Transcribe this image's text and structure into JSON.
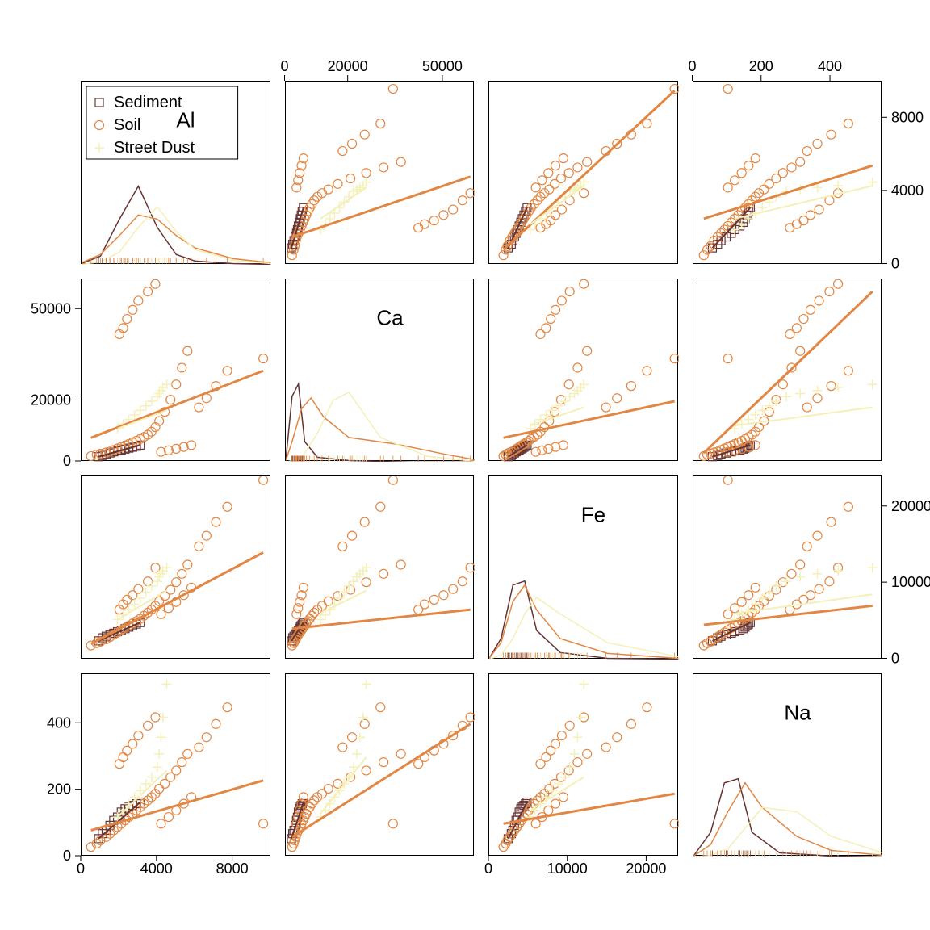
{
  "variables": [
    "Al",
    "Ca",
    "Fe",
    "Na"
  ],
  "groups": [
    "Sediment",
    "Soil",
    "Street Dust"
  ],
  "colors": {
    "Sediment": "#663333",
    "Soil": "#E28743",
    "Street Dust": "#F4F0B8"
  },
  "marker": {
    "Sediment": "square",
    "Soil": "circle",
    "Street Dust": "plus"
  },
  "ranges": {
    "Al": [
      0,
      10000
    ],
    "Ca": [
      0,
      60000
    ],
    "Fe": [
      0,
      24000
    ],
    "Na": [
      0,
      550
    ]
  },
  "axis_top": {
    "Ca": [
      0,
      20000,
      50000
    ],
    "Na": [
      0,
      200,
      400
    ]
  },
  "axis_bottom": {
    "Al": [
      0,
      4000,
      8000
    ],
    "Fe": [
      0,
      10000,
      20000
    ]
  },
  "axis_left": {
    "Ca": [
      0,
      20000,
      50000
    ],
    "Na": [
      0,
      200,
      400
    ]
  },
  "axis_right": {
    "Al": [
      0,
      4000,
      8000
    ],
    "Fe": [
      0,
      10000,
      20000
    ]
  },
  "legend": {
    "title": "",
    "items": [
      "Sediment",
      "Soil",
      "Street Dust"
    ]
  },
  "chart_data": {
    "type": "scatter_matrix",
    "variables": [
      "Al",
      "Ca",
      "Fe",
      "Na"
    ],
    "series": [
      {
        "name": "Sediment",
        "points": [
          {
            "Al": 900,
            "Ca": 1800,
            "Fe": 2400,
            "Na": 55
          },
          {
            "Al": 1100,
            "Ca": 2200,
            "Fe": 2800,
            "Na": 70
          },
          {
            "Al": 1300,
            "Ca": 2600,
            "Fe": 3000,
            "Na": 80
          },
          {
            "Al": 1500,
            "Ca": 3000,
            "Fe": 3200,
            "Na": 95
          },
          {
            "Al": 1700,
            "Ca": 3400,
            "Fe": 3400,
            "Na": 110
          },
          {
            "Al": 1900,
            "Ca": 3700,
            "Fe": 3600,
            "Na": 120
          },
          {
            "Al": 2100,
            "Ca": 4000,
            "Fe": 3800,
            "Na": 135
          },
          {
            "Al": 2300,
            "Ca": 4300,
            "Fe": 4000,
            "Na": 145
          },
          {
            "Al": 2500,
            "Ca": 4600,
            "Fe": 4200,
            "Na": 150
          },
          {
            "Al": 2700,
            "Ca": 4900,
            "Fe": 4400,
            "Na": 155
          },
          {
            "Al": 2900,
            "Ca": 5200,
            "Fe": 4600,
            "Na": 160
          },
          {
            "Al": 3100,
            "Ca": 5600,
            "Fe": 4800,
            "Na": 165
          }
        ]
      },
      {
        "name": "Soil",
        "points": [
          {
            "Al": 500,
            "Ca": 2000,
            "Fe": 1800,
            "Na": 30
          },
          {
            "Al": 800,
            "Ca": 2500,
            "Fe": 2100,
            "Na": 40
          },
          {
            "Al": 1000,
            "Ca": 2800,
            "Fe": 2300,
            "Na": 50
          },
          {
            "Al": 1300,
            "Ca": 3200,
            "Fe": 2600,
            "Na": 60
          },
          {
            "Al": 1500,
            "Ca": 3500,
            "Fe": 2900,
            "Na": 70
          },
          {
            "Al": 1700,
            "Ca": 4000,
            "Fe": 3200,
            "Na": 80
          },
          {
            "Al": 1900,
            "Ca": 4500,
            "Fe": 3500,
            "Na": 90
          },
          {
            "Al": 2100,
            "Ca": 5000,
            "Fe": 3800,
            "Na": 100
          },
          {
            "Al": 2300,
            "Ca": 5500,
            "Fe": 4100,
            "Na": 110
          },
          {
            "Al": 2500,
            "Ca": 6000,
            "Fe": 4400,
            "Na": 120
          },
          {
            "Al": 2700,
            "Ca": 6500,
            "Fe": 4700,
            "Na": 130
          },
          {
            "Al": 2900,
            "Ca": 7000,
            "Fe": 5000,
            "Na": 140
          },
          {
            "Al": 3100,
            "Ca": 7600,
            "Fe": 5300,
            "Na": 150
          },
          {
            "Al": 3300,
            "Ca": 8300,
            "Fe": 5700,
            "Na": 160
          },
          {
            "Al": 3500,
            "Ca": 9000,
            "Fe": 6100,
            "Na": 170
          },
          {
            "Al": 3700,
            "Ca": 10000,
            "Fe": 6500,
            "Na": 180
          },
          {
            "Al": 3900,
            "Ca": 11500,
            "Fe": 7000,
            "Na": 190
          },
          {
            "Al": 4100,
            "Ca": 13500,
            "Fe": 7600,
            "Na": 205
          },
          {
            "Al": 4400,
            "Ca": 16500,
            "Fe": 8300,
            "Na": 220
          },
          {
            "Al": 4700,
            "Ca": 20500,
            "Fe": 9100,
            "Na": 240
          },
          {
            "Al": 5000,
            "Ca": 25500,
            "Fe": 10100,
            "Na": 260
          },
          {
            "Al": 5300,
            "Ca": 31000,
            "Fe": 11200,
            "Na": 285
          },
          {
            "Al": 5600,
            "Ca": 36500,
            "Fe": 12400,
            "Na": 310
          },
          {
            "Al": 2000,
            "Ca": 42000,
            "Fe": 6500,
            "Na": 280
          },
          {
            "Al": 2200,
            "Ca": 44000,
            "Fe": 7200,
            "Na": 300
          },
          {
            "Al": 2400,
            "Ca": 47000,
            "Fe": 7800,
            "Na": 320
          },
          {
            "Al": 2700,
            "Ca": 50000,
            "Fe": 8400,
            "Na": 340
          },
          {
            "Al": 3000,
            "Ca": 53000,
            "Fe": 9200,
            "Na": 365
          },
          {
            "Al": 3500,
            "Ca": 56000,
            "Fe": 10200,
            "Na": 395
          },
          {
            "Al": 3900,
            "Ca": 58500,
            "Fe": 12000,
            "Na": 420
          },
          {
            "Al": 9600,
            "Ca": 34000,
            "Fe": 23500,
            "Na": 100
          },
          {
            "Al": 6200,
            "Ca": 18000,
            "Fe": 14800,
            "Na": 330
          },
          {
            "Al": 6600,
            "Ca": 21000,
            "Fe": 16200,
            "Na": 360
          },
          {
            "Al": 7100,
            "Ca": 25000,
            "Fe": 18000,
            "Na": 400
          },
          {
            "Al": 7700,
            "Ca": 30000,
            "Fe": 20000,
            "Na": 450
          },
          {
            "Al": 4200,
            "Ca": 3400,
            "Fe": 5900,
            "Na": 100
          },
          {
            "Al": 4600,
            "Ca": 3900,
            "Fe": 6700,
            "Na": 120
          },
          {
            "Al": 5000,
            "Ca": 4400,
            "Fe": 7500,
            "Na": 140
          },
          {
            "Al": 5400,
            "Ca": 5000,
            "Fe": 8400,
            "Na": 160
          },
          {
            "Al": 5800,
            "Ca": 5600,
            "Fe": 9400,
            "Na": 180
          }
        ]
      },
      {
        "name": "Street Dust",
        "points": [
          {
            "Al": 1900,
            "Ca": 11000,
            "Fe": 5200,
            "Na": 120
          },
          {
            "Al": 2200,
            "Ca": 12500,
            "Fe": 5800,
            "Na": 140
          },
          {
            "Al": 2500,
            "Ca": 14000,
            "Fe": 6500,
            "Na": 160
          },
          {
            "Al": 2800,
            "Ca": 15500,
            "Fe": 7200,
            "Na": 180
          },
          {
            "Al": 3100,
            "Ca": 17000,
            "Fe": 8000,
            "Na": 200
          },
          {
            "Al": 3400,
            "Ca": 18500,
            "Fe": 8800,
            "Na": 220
          },
          {
            "Al": 3700,
            "Ca": 20000,
            "Fe": 9600,
            "Na": 240
          },
          {
            "Al": 4000,
            "Ca": 21500,
            "Fe": 10200,
            "Na": 270
          },
          {
            "Al": 4100,
            "Ca": 22500,
            "Fe": 10800,
            "Na": 310
          },
          {
            "Al": 4200,
            "Ca": 23500,
            "Fe": 11200,
            "Na": 360
          },
          {
            "Al": 4300,
            "Ca": 24500,
            "Fe": 11600,
            "Na": 420
          },
          {
            "Al": 4500,
            "Ca": 25500,
            "Fe": 12000,
            "Na": 520
          }
        ]
      }
    ],
    "densities": {
      "Al": {
        "Sediment": {
          "x": [
            0,
            1000,
            2000,
            3000,
            4000,
            5000,
            6000,
            8000,
            10000
          ],
          "y": [
            0.01,
            0.1,
            0.55,
            0.95,
            0.45,
            0.12,
            0.04,
            0.01,
            0.0
          ]
        },
        "Soil": {
          "x": [
            0,
            1000,
            2000,
            3000,
            4000,
            5000,
            6000,
            8000,
            10000
          ],
          "y": [
            0.02,
            0.12,
            0.35,
            0.6,
            0.55,
            0.35,
            0.2,
            0.07,
            0.02
          ]
        },
        "Street Dust": {
          "x": [
            0,
            1000,
            2000,
            3000,
            4000,
            5000,
            6000,
            8000,
            10000
          ],
          "y": [
            0.0,
            0.03,
            0.15,
            0.45,
            0.7,
            0.4,
            0.18,
            0.05,
            0.01
          ]
        }
      },
      "Ca": {
        "Sediment": {
          "x": [
            0,
            2000,
            4000,
            6000,
            10000,
            20000,
            40000,
            60000
          ],
          "y": [
            0.02,
            0.8,
            0.95,
            0.25,
            0.06,
            0.02,
            0.0,
            0.0
          ]
        },
        "Soil": {
          "x": [
            0,
            2000,
            5000,
            8000,
            12000,
            20000,
            35000,
            50000,
            60000
          ],
          "y": [
            0.02,
            0.25,
            0.65,
            0.78,
            0.55,
            0.3,
            0.22,
            0.1,
            0.03
          ]
        },
        "Street Dust": {
          "x": [
            0,
            5000,
            10000,
            15000,
            20000,
            30000,
            45000,
            60000
          ],
          "y": [
            0.0,
            0.05,
            0.35,
            0.75,
            0.85,
            0.3,
            0.07,
            0.01
          ]
        }
      },
      "Fe": {
        "Sediment": {
          "x": [
            0,
            1500,
            3000,
            4500,
            6000,
            9000,
            15000,
            24000
          ],
          "y": [
            0.01,
            0.25,
            0.9,
            0.95,
            0.35,
            0.08,
            0.01,
            0.0
          ]
        },
        "Soil": {
          "x": [
            0,
            1500,
            3000,
            4500,
            6000,
            9000,
            15000,
            24000
          ],
          "y": [
            0.01,
            0.2,
            0.7,
            0.9,
            0.6,
            0.25,
            0.07,
            0.01
          ]
        },
        "Street Dust": {
          "x": [
            0,
            1500,
            3000,
            4500,
            6000,
            9000,
            15000,
            24000
          ],
          "y": [
            0.0,
            0.05,
            0.25,
            0.55,
            0.75,
            0.55,
            0.2,
            0.03
          ]
        }
      },
      "Na": {
        "Sediment": {
          "x": [
            0,
            50,
            90,
            130,
            170,
            250,
            400,
            550
          ],
          "y": [
            0.01,
            0.3,
            0.9,
            0.95,
            0.3,
            0.05,
            0.01,
            0.0
          ]
        },
        "Soil": {
          "x": [
            0,
            50,
            100,
            150,
            200,
            300,
            400,
            550
          ],
          "y": [
            0.01,
            0.15,
            0.55,
            0.9,
            0.6,
            0.25,
            0.08,
            0.02
          ]
        },
        "Street Dust": {
          "x": [
            0,
            50,
            100,
            150,
            200,
            300,
            400,
            550
          ],
          "y": [
            0.0,
            0.02,
            0.1,
            0.35,
            0.6,
            0.55,
            0.25,
            0.05
          ]
        }
      }
    },
    "regressions": {
      "Al_Ca": {
        "Sediment": [
          [
            900,
            1800
          ],
          [
            3100,
            5600
          ]
        ],
        "Soil": [
          [
            500,
            8000
          ],
          [
            9600,
            30000
          ]
        ],
        "Street Dust": [
          [
            1900,
            11000
          ],
          [
            4500,
            17000
          ]
        ]
      },
      "Al_Fe": {
        "Sediment": [
          [
            900,
            2400
          ],
          [
            3100,
            4800
          ]
        ],
        "Soil": [
          [
            500,
            2000
          ],
          [
            9600,
            14000
          ]
        ],
        "Street Dust": [
          [
            1900,
            5200
          ],
          [
            4500,
            9000
          ]
        ]
      },
      "Al_Na": {
        "Sediment": [
          [
            900,
            55
          ],
          [
            3100,
            165
          ]
        ],
        "Soil": [
          [
            500,
            80
          ],
          [
            9600,
            230
          ]
        ],
        "Street Dust": [
          [
            1900,
            120
          ],
          [
            4500,
            260
          ]
        ]
      },
      "Ca_Al": {
        "Sediment": [
          [
            1800,
            900
          ],
          [
            5600,
            3100
          ]
        ],
        "Soil": [
          [
            2000,
            1500
          ],
          [
            58500,
            4800
          ]
        ],
        "Street Dust": [
          [
            11000,
            2500
          ],
          [
            25500,
            4200
          ]
        ]
      },
      "Ca_Fe": {
        "Sediment": [
          [
            1800,
            2400
          ],
          [
            5600,
            4800
          ]
        ],
        "Soil": [
          [
            2000,
            4000
          ],
          [
            58500,
            6500
          ]
        ],
        "Street Dust": [
          [
            11000,
            6000
          ],
          [
            25500,
            9000
          ]
        ]
      },
      "Ca_Na": {
        "Sediment": [
          [
            1800,
            55
          ],
          [
            5600,
            165
          ]
        ],
        "Soil": [
          [
            2000,
            60
          ],
          [
            58500,
            400
          ]
        ],
        "Street Dust": [
          [
            11000,
            130
          ],
          [
            25500,
            300
          ]
        ]
      },
      "Fe_Al": {
        "Sediment": [
          [
            2400,
            900
          ],
          [
            4800,
            3100
          ]
        ],
        "Soil": [
          [
            1800,
            800
          ],
          [
            23500,
            9500
          ]
        ],
        "Street Dust": [
          [
            5200,
            2200
          ],
          [
            12000,
            4300
          ]
        ]
      },
      "Fe_Ca": {
        "Sediment": [
          [
            2400,
            1800
          ],
          [
            4800,
            5600
          ]
        ],
        "Soil": [
          [
            1800,
            8000
          ],
          [
            23500,
            20000
          ]
        ],
        "Street Dust": [
          [
            5200,
            12000
          ],
          [
            12000,
            18000
          ]
        ]
      },
      "Fe_Na": {
        "Sediment": [
          [
            2400,
            55
          ],
          [
            4800,
            165
          ]
        ],
        "Soil": [
          [
            1800,
            100
          ],
          [
            23500,
            190
          ]
        ],
        "Street Dust": [
          [
            5200,
            140
          ],
          [
            12000,
            240
          ]
        ]
      },
      "Na_Al": {
        "Sediment": [
          [
            55,
            900
          ],
          [
            165,
            3100
          ]
        ],
        "Soil": [
          [
            30,
            2500
          ],
          [
            520,
            5400
          ]
        ],
        "Street Dust": [
          [
            120,
            2500
          ],
          [
            520,
            4300
          ]
        ]
      },
      "Na_Ca": {
        "Sediment": [
          [
            55,
            1800
          ],
          [
            165,
            5600
          ]
        ],
        "Soil": [
          [
            30,
            3000
          ],
          [
            520,
            56000
          ]
        ],
        "Street Dust": [
          [
            120,
            12000
          ],
          [
            520,
            18000
          ]
        ]
      },
      "Na_Fe": {
        "Sediment": [
          [
            55,
            2400
          ],
          [
            165,
            4800
          ]
        ],
        "Soil": [
          [
            30,
            4500
          ],
          [
            520,
            7000
          ]
        ],
        "Street Dust": [
          [
            120,
            6000
          ],
          [
            520,
            8500
          ]
        ]
      }
    }
  }
}
